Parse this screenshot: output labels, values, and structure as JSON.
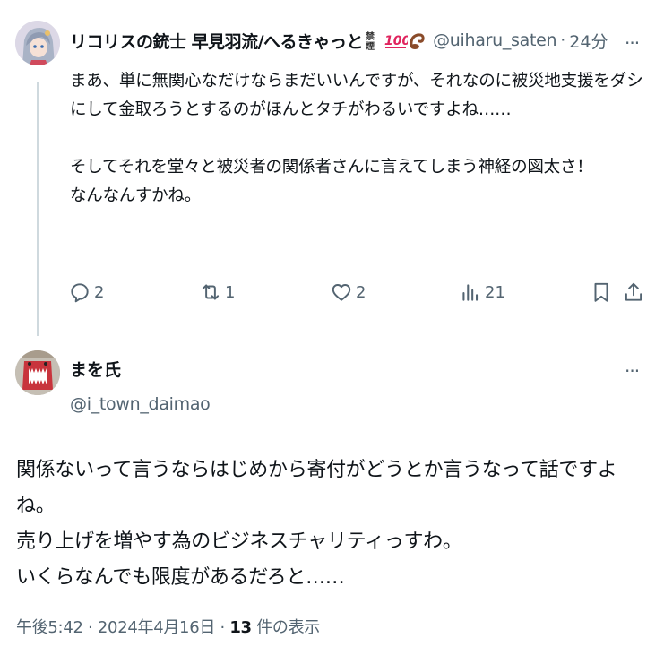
{
  "parent_tweet": {
    "display_name": "リコリスの銃士 早見羽流/へるきゃっと",
    "handle": "@uiharu_saten",
    "separator": "·",
    "time": "24分",
    "body": "まあ、単に無関心なだけならまだいいんですが、それなのに被災地支援をダシにして金取ろうとするのがほんとタチがわるいですよね……\n\nそしてそれを堂々と被災者の関係者さんに言えてしまう神経の図太さ！\nなんなんすかね。",
    "replies": "2",
    "reposts": "1",
    "likes": "2",
    "views": "21",
    "more_label": "···"
  },
  "main_tweet": {
    "display_name": "まを氏",
    "handle": "@i_town_daimao",
    "body": "関係ないって言うならはじめから寄付がどうとか言うなって話ですよね。\n売り上げを増やす為のビジネスチャリティっすわ。\nいくらなんでも限度があるだろと……",
    "more_label": "···",
    "time": "午後5:42",
    "separator": "·",
    "date": "2024年4月16日",
    "views_count": "13",
    "views_label": "件の表示"
  },
  "icons": {
    "reply": "reply-icon",
    "repost": "repost-icon",
    "like": "like-icon",
    "views": "views-icon",
    "bookmark": "bookmark-icon",
    "share": "share-icon",
    "more": "more-icon"
  },
  "colors": {
    "text": "#0f1419",
    "secondary": "#536471",
    "thread_line": "#cfd9de",
    "emoji_red": "#e0245e"
  }
}
